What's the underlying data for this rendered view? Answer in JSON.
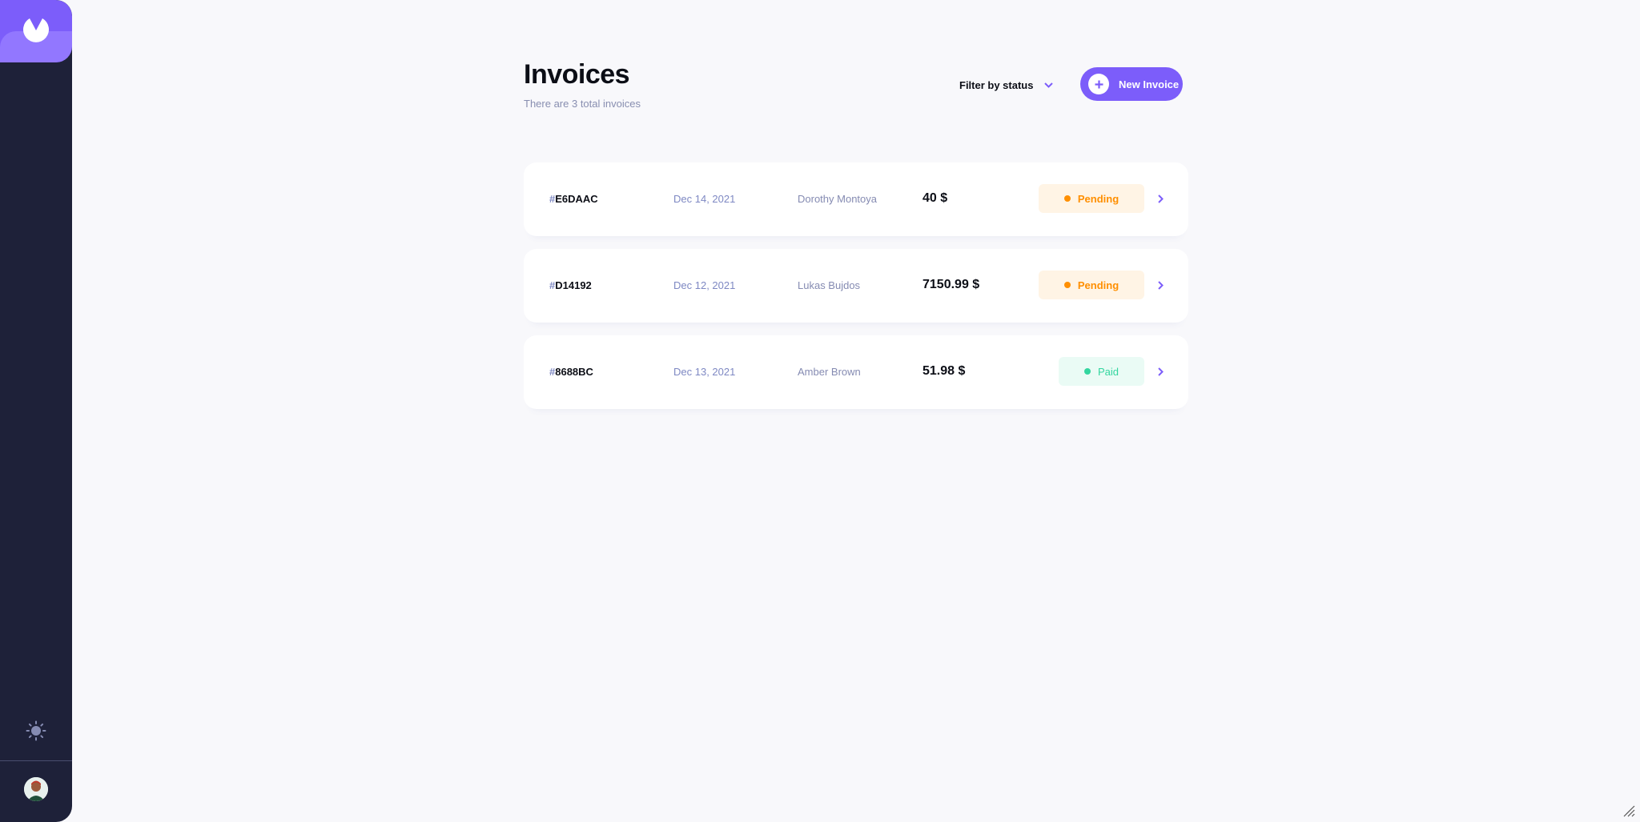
{
  "header": {
    "title": "Invoices",
    "subtitle": "There are 3 total invoices"
  },
  "filter": {
    "label": "Filter by status",
    "icon": "chevron-down-icon"
  },
  "new_invoice": {
    "label": "New Invoice",
    "icon": "plus-icon"
  },
  "sidebar": {
    "logo_icon": "app-logo-icon",
    "theme_icon": "sun-icon",
    "avatar_icon": "user-avatar"
  },
  "invoices": [
    {
      "hash": "#",
      "id": "E6DAAC",
      "date": "Dec 14, 2021",
      "client": "Dorothy Montoya",
      "amount": "40 $",
      "status": "Pending"
    },
    {
      "hash": "#",
      "id": "D14192",
      "date": "Dec 12, 2021",
      "client": "Lukas Bujdos",
      "amount": "7150.99 $",
      "status": "Pending"
    },
    {
      "hash": "#",
      "id": "8688BC",
      "date": "Dec 13, 2021",
      "client": "Amber Brown",
      "amount": "51.98 $",
      "status": "Paid"
    }
  ],
  "colors": {
    "accent": "#7C5DFA",
    "sidebar": "#1E2139",
    "pending": "#FF8F00",
    "paid": "#33D69F",
    "background": "#F8F8FB"
  }
}
